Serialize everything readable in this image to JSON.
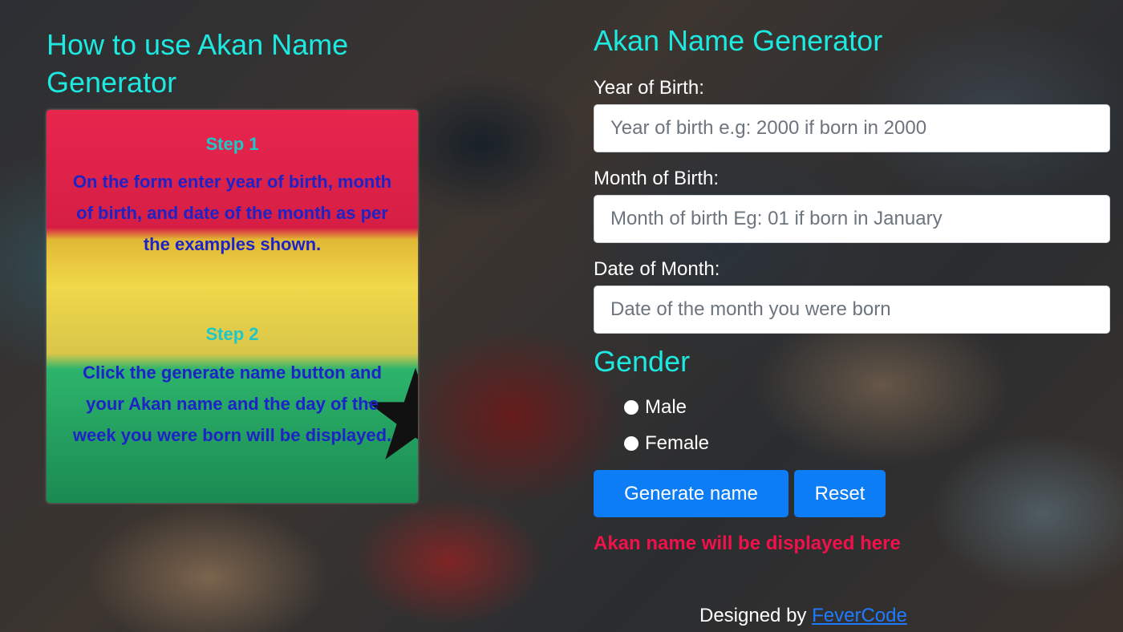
{
  "left_panel": {
    "title": "How to use Akan Name Generator",
    "step1_heading": "Step 1",
    "step1_text": "On the form enter year of birth, month of birth, and date of the month as per the examples shown.",
    "step2_heading": "Step 2",
    "step2_text": "Click the generate name button and your Akan name and the day of the week you were born will be displayed."
  },
  "form": {
    "title": "Akan Name Generator",
    "year_label": "Year of Birth:",
    "year_placeholder": "Year of birth e.g: 2000 if born in 2000",
    "month_label": "Month of Birth:",
    "month_placeholder": "Month of birth Eg: 01 if born in January",
    "date_label": "Date of Month:",
    "date_placeholder": "Date of the month you were born",
    "gender_title": "Gender",
    "gender_options": [
      "Male",
      "Female"
    ],
    "generate_label": "Generate name",
    "reset_label": "Reset",
    "result_text": "Akan name will be displayed here"
  },
  "footer": {
    "prefix": "Designed by",
    "link_text": "FeverCode"
  },
  "colors": {
    "accent_cyan": "#1de9e0",
    "button_blue": "#0d7df5",
    "result_red": "#f0114a",
    "step_text_blue": "#1d23c7"
  },
  "icons": [
    "ghana-flag-star-icon",
    "radio-icon"
  ]
}
